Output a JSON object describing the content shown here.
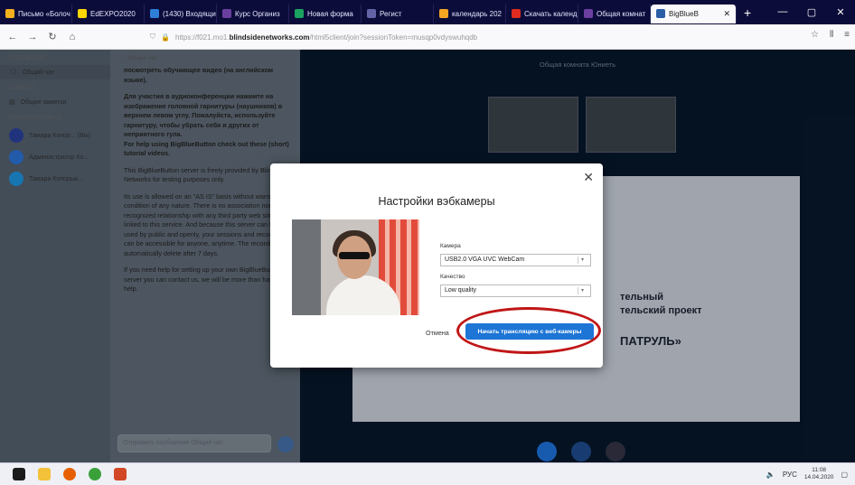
{
  "tabs": [
    {
      "label": "Письмо «Болоч",
      "color": "#f2b01e"
    },
    {
      "label": "EdEXPO2020",
      "color": "#ffd700"
    },
    {
      "label": "(1430) Входящи",
      "color": "#2f7ed8"
    },
    {
      "label": "Курс Организ",
      "color": "#6b3fa0"
    },
    {
      "label": "Новая форма",
      "color": "#1aa260"
    },
    {
      "label": "Регист",
      "color": "#6264a7"
    },
    {
      "label": "календарь 202",
      "color": "#f5a623"
    },
    {
      "label": "Скачать календ",
      "color": "#e02b20"
    },
    {
      "label": "Общая комнат",
      "color": "#6b3fa0"
    },
    {
      "label": "BigBlueB",
      "color": "#2a5ea7",
      "active": true
    }
  ],
  "url": {
    "prefix": "https://f021.mo1.",
    "domain": "blindsidenetworks.com",
    "path": "/html5client/join?sessionToken=musqp0vdyswuhqdb"
  },
  "sidebar": {
    "messages_header": "СООБЩЕНИЯ",
    "public_chat": "Общий чат",
    "notes_header": "ЗАМЕТКИ",
    "shared_notes": "Общие заметки",
    "users_header": "ПОЛЬЗОВАТЕЛИ (3)",
    "users": [
      {
        "name": "Тамара Копор... (Вы)",
        "color": "#2a3f99"
      },
      {
        "name": "Администратор Ко...",
        "color": "#2a6fd0"
      },
      {
        "name": "Тамара Копорык...",
        "color": "#1d8fd8"
      }
    ]
  },
  "chat": {
    "header": "‹ Общий чат",
    "p1": "посмотреть обучающее видео (на английском языке).",
    "p2": "Для участия в аудиоконференции нажмите на изображение головной гарнитуры (наушников) в верхнем левом углу. Пожалуйста, используйте гарнитуру, чтобы убрать себя и других от неприятного гула.",
    "p2b": "For help using BigBlueButton check out these (short) tutorial videos.",
    "p3": "This BigBlueButton server is freely provided by Blindside Networks for testing purposes only.",
    "p4": "Its use is allowed on an \"AS IS\" basis without warranty or condition of any nature. There is no association nor recognized relationship with any third party web sites linked to this service. And because this server can be used by public and openly, your sessions and recordings can be accessible for anyone, anytime. The recordings automatically delete after 7 days.",
    "p5": "If you need help for setting up your own BigBlueButton server you can contact us, we will be more than happy to help.",
    "input_placeholder": "Отправить сообщение Общий чат"
  },
  "main": {
    "title": "Общая комната Юниеть",
    "presentation_lines": [
      "тельный",
      "тельский проект",
      "ПАТРУЛЬ»"
    ]
  },
  "modal": {
    "title": "Настройки вэбкамеры",
    "camera_label": "Камера",
    "camera_value": "USB2.0 VGA UVC WebCam",
    "quality_label": "Качество",
    "quality_value": "Low quality",
    "cancel": "Отмена",
    "start": "Начать трансляцию с веб-камеры"
  },
  "tray": {
    "lang": "РУС",
    "time": "11:08",
    "date": "14.04.2020"
  }
}
